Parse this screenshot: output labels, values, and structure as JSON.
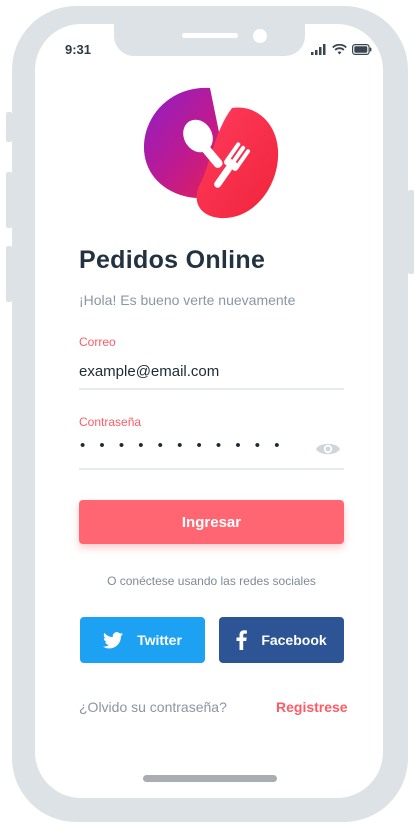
{
  "status": {
    "time": "9:31"
  },
  "app": {
    "title": "Pedidos Online",
    "subtitle": "¡Hola! Es bueno verte nuevamente"
  },
  "form": {
    "email_label": "Correo",
    "email_value": "example@email.com",
    "password_label": "Contraseña",
    "password_value": "• • • • • • • • • • •"
  },
  "actions": {
    "login_label": "Ingresar",
    "social_caption": "O conéctese usando las redes sociales",
    "twitter_label": "Twitter",
    "facebook_label": "Facebook",
    "forgot_label": "¿Olvido su contraseña?",
    "register_label": "Registrese"
  },
  "icons": [
    "signal-icon",
    "wifi-icon",
    "battery-icon",
    "eye-icon",
    "twitter-icon",
    "facebook-icon",
    "app-logo"
  ],
  "colors": {
    "accent": "#ff6671",
    "twitter": "#1da1f2",
    "facebook": "#2d5596",
    "title": "#233240"
  }
}
